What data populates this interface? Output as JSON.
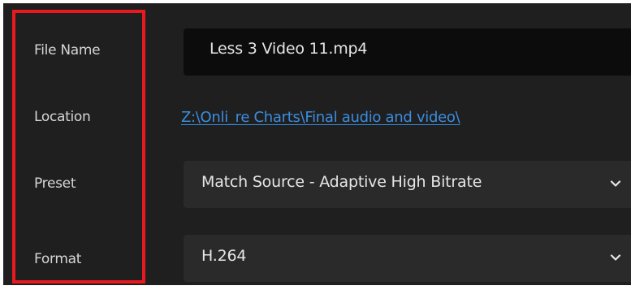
{
  "export_settings": {
    "file_name": {
      "label": "File Name",
      "value": "Less 3 Video 11.mp4"
    },
    "location": {
      "label": "Location",
      "value": "Z:\\Onli_re Charts\\Final audio and video\\"
    },
    "preset": {
      "label": "Preset",
      "selected": "Match Source - Adaptive High Bitrate"
    },
    "format": {
      "label": "Format",
      "selected": "H.264"
    }
  },
  "icons": {
    "dropdown": "chevron-down-icon"
  },
  "colors": {
    "panel_background": "#1f1f1f",
    "input_background": "#0c0c0c",
    "select_background": "#2a2a2a",
    "label_text": "#d6d6d6",
    "link": "#3b8de0",
    "highlight_border": "#e8191f"
  }
}
